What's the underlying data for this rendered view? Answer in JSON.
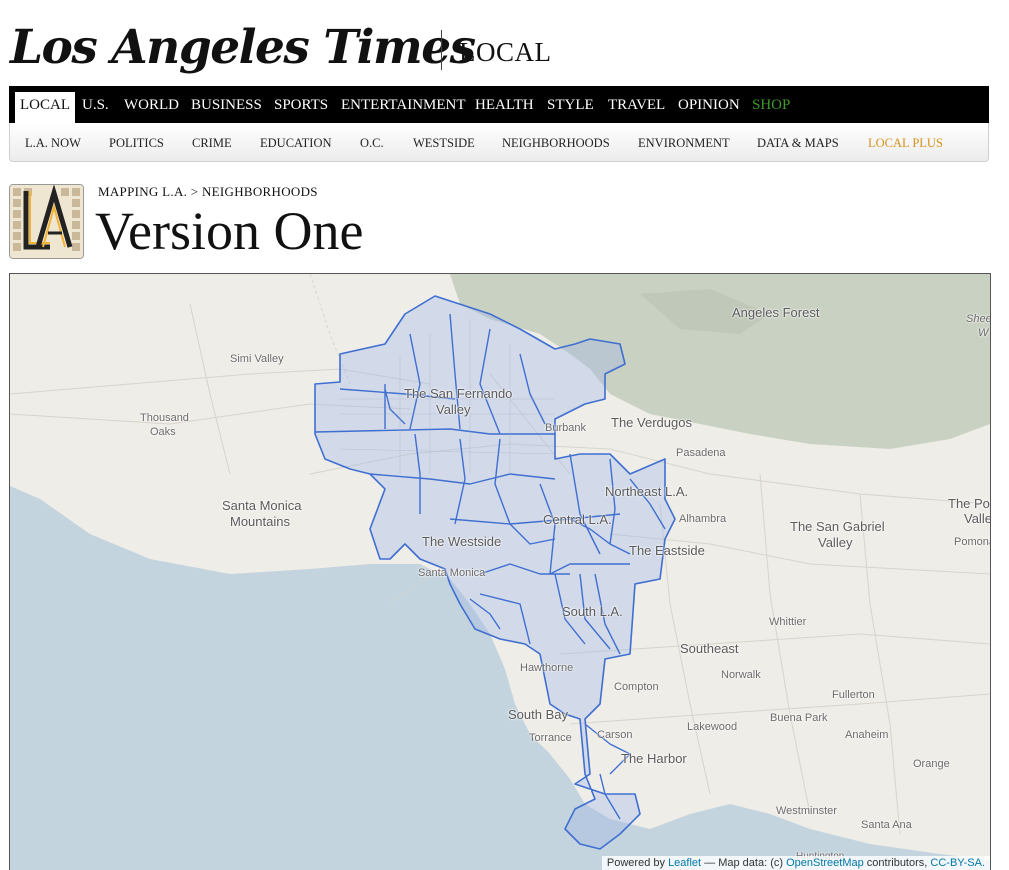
{
  "masthead": {
    "logo": "Los Angeles Times",
    "section": "LOCAL"
  },
  "nav_primary": [
    {
      "label": "LOCAL",
      "active": true
    },
    {
      "label": "U.S."
    },
    {
      "label": "WORLD"
    },
    {
      "label": "BUSINESS"
    },
    {
      "label": "SPORTS"
    },
    {
      "label": "ENTERTAINMENT"
    },
    {
      "label": "HEALTH"
    },
    {
      "label": "STYLE"
    },
    {
      "label": "TRAVEL"
    },
    {
      "label": "OPINION"
    },
    {
      "label": "SHOP",
      "color": "#3f9a2a"
    }
  ],
  "nav_secondary": [
    {
      "label": "L.A. NOW"
    },
    {
      "label": "POLITICS"
    },
    {
      "label": "CRIME"
    },
    {
      "label": "EDUCATION"
    },
    {
      "label": "O.C."
    },
    {
      "label": "WESTSIDE"
    },
    {
      "label": "NEIGHBORHOODS"
    },
    {
      "label": "ENVIRONMENT"
    },
    {
      "label": "DATA & MAPS"
    },
    {
      "label": "LOCAL PLUS",
      "color": "#d6911c"
    }
  ],
  "breadcrumb": {
    "parent": "MAPPING L.A.",
    "separator": ">",
    "current": "NEIGHBORHOODS"
  },
  "page_title": "Version One",
  "map": {
    "labels": {
      "angeles_forest": "Angeles Forest",
      "sheep": "Shee",
      "sheep2": "W",
      "simi_valley": "Simi Valley",
      "san_fernando_1": "The San Fernando",
      "san_fernando_2": "Valley",
      "thousand_oaks_1": "Thousand",
      "thousand_oaks_2": "Oaks",
      "burbank": "Burbank",
      "verdugos": "The Verdugos",
      "pasadena": "Pasadena",
      "santa_monica_mtns_1": "Santa Monica",
      "santa_monica_mtns_2": "Mountains",
      "northeast_la": "Northeast L.A.",
      "central_la": "Central L.A.",
      "alhambra": "Alhambra",
      "san_gabriel_1": "The San Gabriel",
      "san_gabriel_2": "Valley",
      "pomona_valley_1": "The Pon",
      "pomona_valley_2": "Valle",
      "pomona": "Pomona",
      "westside": "The Westside",
      "eastside": "The Eastside",
      "santa_monica": "Santa Monica",
      "south_la": "South L.A.",
      "whittier": "Whittier",
      "southeast": "Southeast",
      "hawthorne": "Hawthorne",
      "norwalk": "Norwalk",
      "compton": "Compton",
      "fullerton": "Fullerton",
      "south_bay": "South Bay",
      "buena_park": "Buena Park",
      "lakewood": "Lakewood",
      "anaheim": "Anaheim",
      "torrance": "Torrance",
      "carson": "Carson",
      "harbor": "The Harbor",
      "orange": "Orange",
      "westminster": "Westminster",
      "santa_ana": "Santa Ana",
      "huntington": "Huntington"
    },
    "attribution": {
      "prefix": "Powered by",
      "leaflet": "Leaflet",
      "middle": "— Map data: (c)",
      "osm": "OpenStreetMap",
      "suffix": "contributors,",
      "license": "CC-BY-SA."
    },
    "colors": {
      "land": "#efede8",
      "water": "#c4d4de",
      "forest": "#c8d0c2",
      "boundary": "#3f6fd1",
      "boundary_fill": "#9fb4e8"
    }
  }
}
